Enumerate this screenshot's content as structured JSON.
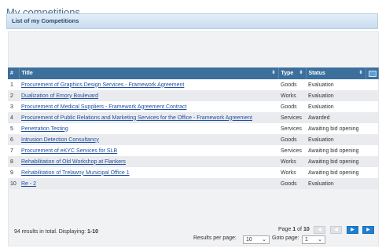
{
  "page": {
    "title": "My competitions"
  },
  "panel": {
    "header": "List of my Competitions"
  },
  "table": {
    "columns": {
      "num": "#",
      "title": "Title",
      "type": "Type",
      "status": "Status"
    },
    "rows": [
      {
        "num": "1",
        "title": "Procurement of Graphics Design Services - Framework Agreement",
        "type": "Goods",
        "status": "Evaluation"
      },
      {
        "num": "2",
        "title": "Dualization of Emory Boulevard",
        "type": "Works",
        "status": "Evaluation"
      },
      {
        "num": "3",
        "title": "Procurement of Medical Suppliers - Framework Agreement Contract",
        "type": "Goods",
        "status": "Evaluation"
      },
      {
        "num": "4",
        "title": "Procurement of Public Relations and Marketing Services for the Office - Framework Agreement",
        "type": "Services",
        "status": "Awarded"
      },
      {
        "num": "5",
        "title": "Penetration Testing",
        "type": "Services",
        "status": "Awaiting bid opening"
      },
      {
        "num": "6",
        "title": "Intrusion Detection Consultancy",
        "type": "Goods",
        "status": "Evaluation"
      },
      {
        "num": "7",
        "title": "Procurement of eKYC Services for SLB",
        "type": "Services",
        "status": "Awaiting bid opening"
      },
      {
        "num": "8",
        "title": "Rehabilitation of Old Workshop at Flankers",
        "type": "Works",
        "status": "Awaiting bid opening"
      },
      {
        "num": "9",
        "title": "Rehabilitation of Trelawny Municipal Office 1",
        "type": "Works",
        "status": "Awaiting bid opening"
      },
      {
        "num": "10",
        "title": "Re - 2",
        "type": "Goods",
        "status": "Evaluation"
      }
    ]
  },
  "footer": {
    "total_prefix": "94 results in total. Displaying: ",
    "range": "1-10",
    "page_word": "Page ",
    "page_current": "1",
    "page_of": " of ",
    "page_total": "10",
    "results_per_page_label": "Results per page:",
    "results_per_page_value": "10",
    "goto_label": "Goto page:",
    "goto_value": "1"
  },
  "colors": {
    "accent_rule": "#e8a623",
    "header_bg": "#3c6f9c",
    "link": "#1f4fa0",
    "nav_active": "#1f7fd0"
  }
}
